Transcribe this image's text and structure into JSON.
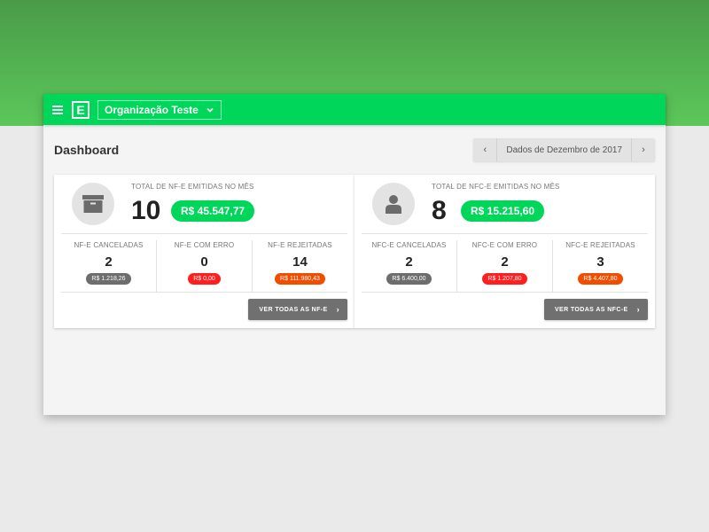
{
  "appbar": {
    "org_name": "Organização Teste",
    "logo_letter": "E",
    "brand_color": "#00d65a"
  },
  "page": {
    "title": "Dashboard",
    "date_label": "Dados de Dezembro de 2017",
    "prev": "‹",
    "next": "›"
  },
  "cards": [
    {
      "icon": "archive-box-icon",
      "caption": "TOTAL DE NF-E EMITIDAS NO MÊS",
      "count": "10",
      "total": "R$ 45.547,77",
      "stats": [
        {
          "label": "NF-E CANCELADAS",
          "count": "2",
          "value": "R$ 1.218,26",
          "color": "#6d6d6d"
        },
        {
          "label": "NF-E COM ERRO",
          "count": "0",
          "value": "R$ 0,00",
          "color": "#ff1f1f"
        },
        {
          "label": "NF-E REJEITADAS",
          "count": "14",
          "value": "R$ 111.980,43",
          "color": "#f04d00"
        }
      ],
      "button": "VER TODAS AS NF-E"
    },
    {
      "icon": "user-icon",
      "caption": "TOTAL DE NFC-E EMITIDAS NO MÊS",
      "count": "8",
      "total": "R$ 15.215,60",
      "stats": [
        {
          "label": "NFC-E CANCELADAS",
          "count": "2",
          "value": "R$ 6.400,00",
          "color": "#6d6d6d"
        },
        {
          "label": "NFC-E COM ERRO",
          "count": "2",
          "value": "R$ 1.207,80",
          "color": "#ff1f1f"
        },
        {
          "label": "NFC-E REJEITADAS",
          "count": "3",
          "value": "R$ 4.407,80",
          "color": "#f04d00"
        }
      ],
      "button": "VER TODAS AS NFC-E"
    }
  ]
}
